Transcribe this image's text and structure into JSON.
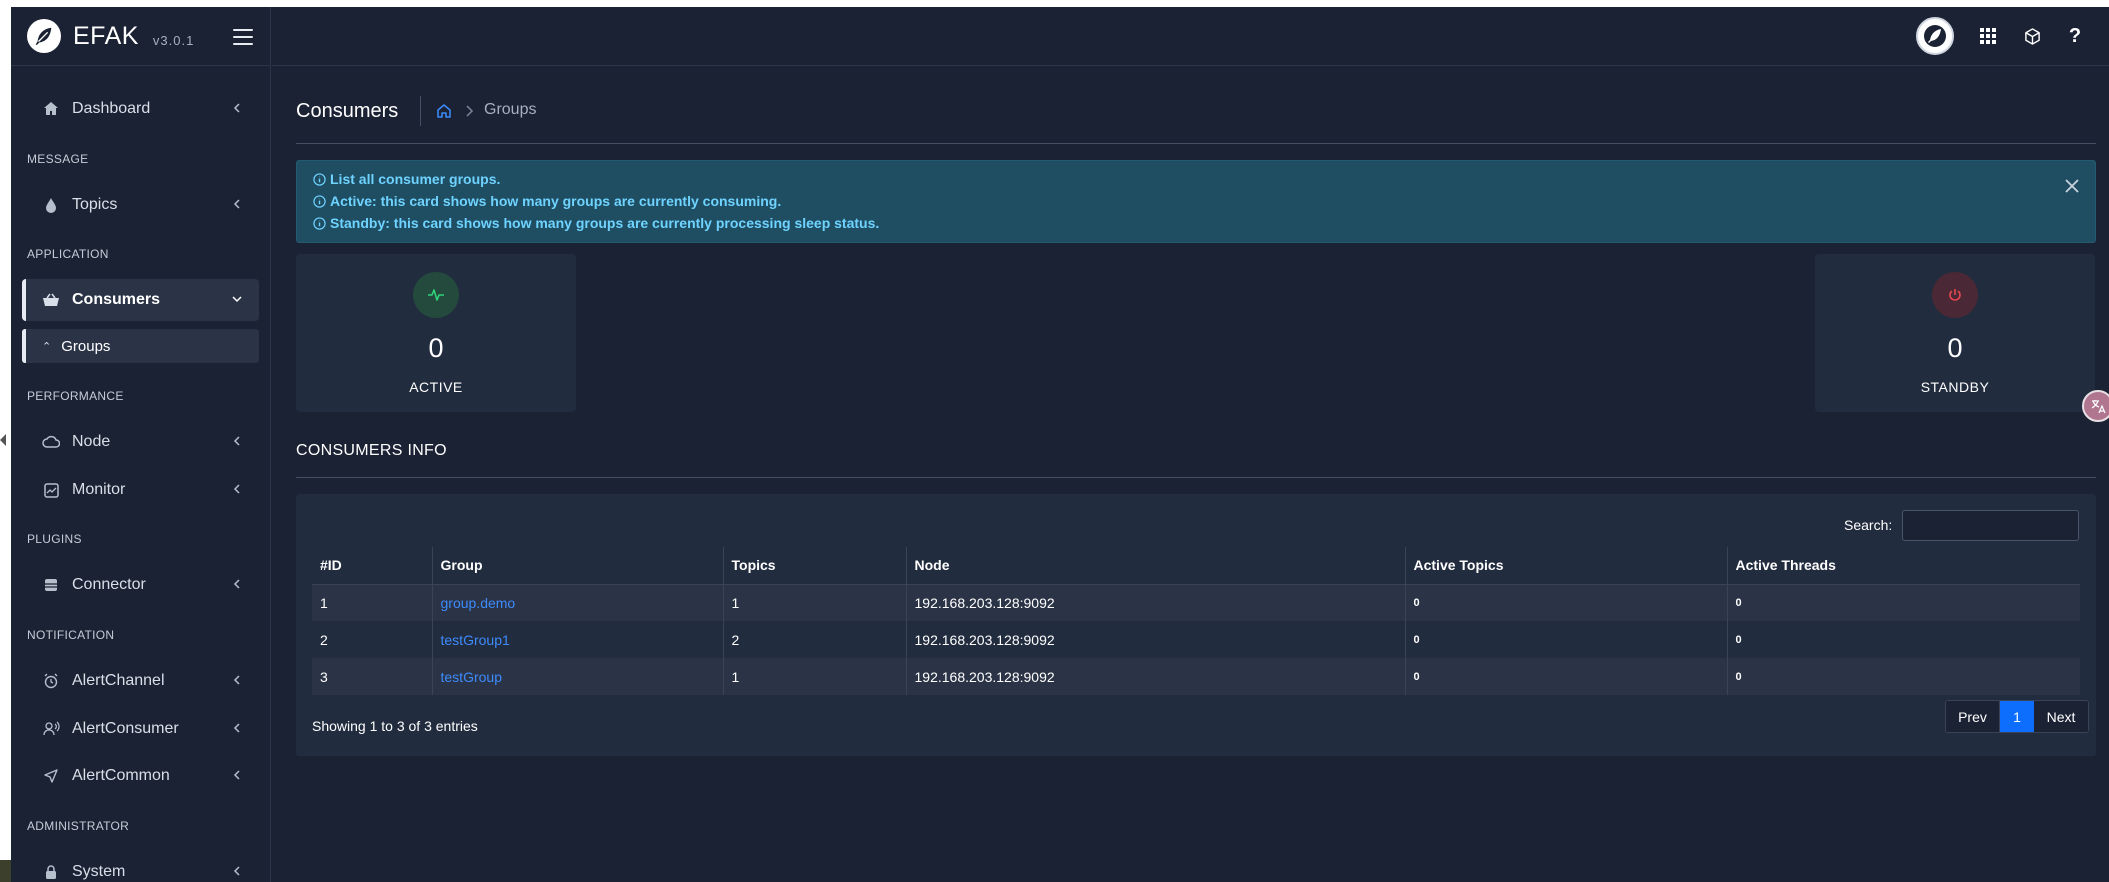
{
  "brand": {
    "name": "EFAK",
    "version": "v3.0.1"
  },
  "sidebar": {
    "dashboard": "Dashboard",
    "sections": {
      "message": "MESSAGE",
      "application": "APPLICATION",
      "performance": "PERFORMANCE",
      "plugins": "PLUGINS",
      "notification": "NOTIFICATION",
      "administrator": "ADMINISTRATOR"
    },
    "items": {
      "topics": "Topics",
      "consumers": "Consumers",
      "groups": "Groups",
      "node": "Node",
      "monitor": "Monitor",
      "connector": "Connector",
      "alert_channel": "AlertChannel",
      "alert_consumer": "AlertConsumer",
      "alert_common": "AlertCommon",
      "system": "System"
    }
  },
  "topbar": {
    "icons": [
      "avatar-icon",
      "apps-grid-icon",
      "cube-icon",
      "help-icon"
    ]
  },
  "page": {
    "title": "Consumers",
    "breadcrumb_current": "Groups"
  },
  "alert": {
    "lines": [
      "List all consumer groups.",
      "Active: this card shows how many groups are currently consuming.",
      "Standby: this card shows how many groups are currently processing sleep status."
    ]
  },
  "stats": {
    "active": {
      "value": "0",
      "label": "ACTIVE"
    },
    "standby": {
      "value": "0",
      "label": "STANDBY"
    }
  },
  "consumers_info": {
    "title": "CONSUMERS INFO",
    "search_label": "Search:",
    "columns": [
      "#ID",
      "Group",
      "Topics",
      "Node",
      "Active Topics",
      "Active Threads"
    ],
    "rows": [
      {
        "id": "1",
        "group": "group.demo",
        "topics": "1",
        "node": "192.168.203.128:9092",
        "active_topics": "0",
        "active_threads": "0"
      },
      {
        "id": "2",
        "group": "testGroup1",
        "topics": "2",
        "node": "192.168.203.128:9092",
        "active_topics": "0",
        "active_threads": "0"
      },
      {
        "id": "3",
        "group": "testGroup",
        "topics": "1",
        "node": "192.168.203.128:9092",
        "active_topics": "0",
        "active_threads": "0"
      }
    ],
    "info": "Showing 1 to 3 of 3 entries",
    "pagination": {
      "prev": "Prev",
      "current": "1",
      "next": "Next"
    }
  },
  "colors": {
    "background": "#1b2233",
    "card": "#222c3f",
    "link": "#3d8bfd",
    "alert_text": "#6fd3ff",
    "active_green": "#2fd27a",
    "standby_red": "#e5484d",
    "page_active": "#0d6efd"
  }
}
